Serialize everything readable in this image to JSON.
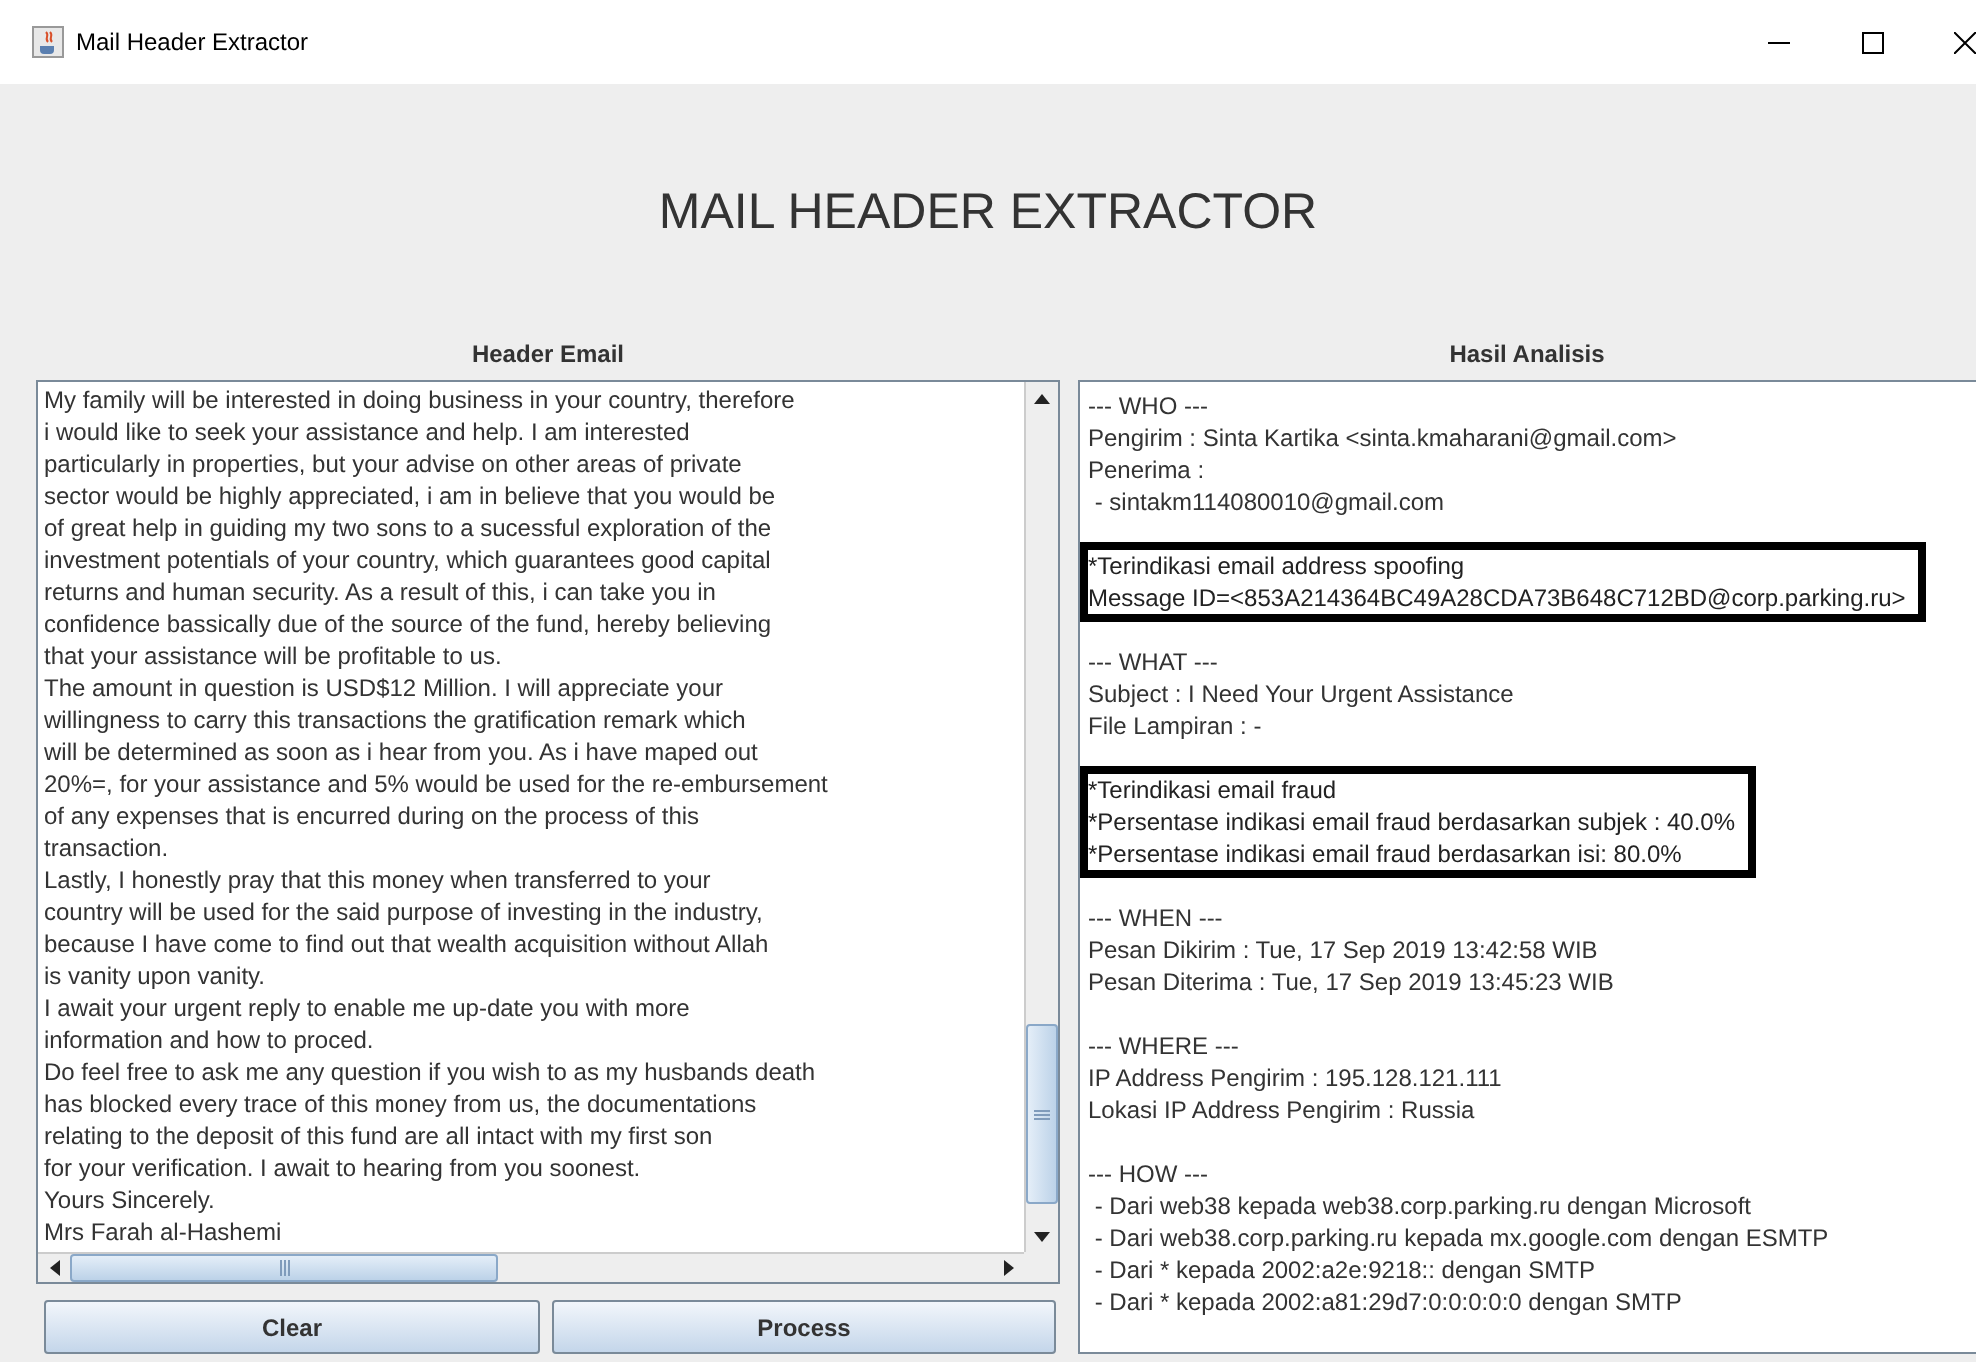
{
  "window": {
    "title": "Mail Header Extractor"
  },
  "heading": "MAIL HEADER EXTRACTOR",
  "header_panel": {
    "label": "Header Email",
    "text_lines": [
      "My family will be interested in doing business in your country, therefore",
      "i would like to seek your assistance and help. I am interested",
      "particularly in properties, but your advise on other areas of private",
      "sector would be highly appreciated, i am in believe that you would be",
      "of great help in guiding my two sons to a sucessful exploration of the",
      "investment potentials of your country, which guarantees good capital",
      "returns and human security. As a result of this, i can take you in",
      "confidence bassically due of the source of the fund, hereby believing",
      "that your assistance will be profitable to us.",
      "The amount in question is USD$12 Million. I will appreciate your",
      "willingness to carry this transactions the gratification remark which",
      "will be determined as soon as i hear from you. As i have maped out",
      "20%=, for your assistance and 5% would be used for the re-embursement",
      "of any expenses that is encurred during on the process of this",
      "transaction.",
      "Lastly, I honestly pray that this money when transferred to your",
      "country will be used for the said purpose of investing in the industry,",
      "because I have come to find out that wealth acquisition without Allah",
      "is vanity upon vanity.",
      "I await your urgent reply to enable me up-date you with more",
      "information and how to proced.",
      "Do feel free to ask me any question if you wish to as my husbands death",
      "has blocked every trace of this money from us, the documentations",
      "relating to the deposit of this fund are all intact with my first son",
      "for your verification. I await to hearing from you soonest.",
      "Yours Sincerely.",
      "Mrs Farah al-Hashemi"
    ]
  },
  "analysis_panel": {
    "label": "Hasil Analisis",
    "blocks": [
      {
        "kind": "plain",
        "lines": [
          "--- WHO ---",
          "Pengirim : Sinta Kartika <sinta.kmaharani@gmail.com>",
          "Penerima :",
          " - sintakm114080010@gmail.com"
        ]
      },
      {
        "kind": "highlight",
        "lines": [
          "*Terindikasi email address spoofing",
          "Message ID=<853A214364BC49A28CDA73B648C712BD@corp.parking.ru>"
        ]
      },
      {
        "kind": "plain",
        "lines": [
          "--- WHAT ---",
          "Subject : I Need Your Urgent Assistance",
          "File Lampiran : -"
        ]
      },
      {
        "kind": "highlight",
        "lines": [
          "*Terindikasi email fraud",
          "*Persentase indikasi email fraud berdasarkan subjek : 40.0%",
          "*Persentase indikasi email fraud berdasarkan isi: 80.0%"
        ]
      },
      {
        "kind": "plain",
        "lines": [
          "--- WHEN ---",
          "Pesan Dikirim : Tue, 17 Sep 2019 13:42:58 WIB",
          "Pesan Diterima : Tue, 17 Sep 2019 13:45:23 WIB"
        ]
      },
      {
        "kind": "plain",
        "lines": [
          "--- WHERE ---",
          "IP Address Pengirim : 195.128.121.111",
          "Lokasi IP Address Pengirim : Russia"
        ]
      },
      {
        "kind": "plain",
        "lines": [
          "--- HOW ---",
          " - Dari web38 kepada web38.corp.parking.ru dengan Microsoft",
          " - Dari web38.corp.parking.ru kepada mx.google.com dengan ESMTP",
          " - Dari * kepada 2002:a2e:9218:: dengan SMTP",
          " - Dari * kepada 2002:a81:29d7:0:0:0:0:0 dengan SMTP"
        ]
      }
    ]
  },
  "buttons": [
    "Clear",
    "Process"
  ]
}
